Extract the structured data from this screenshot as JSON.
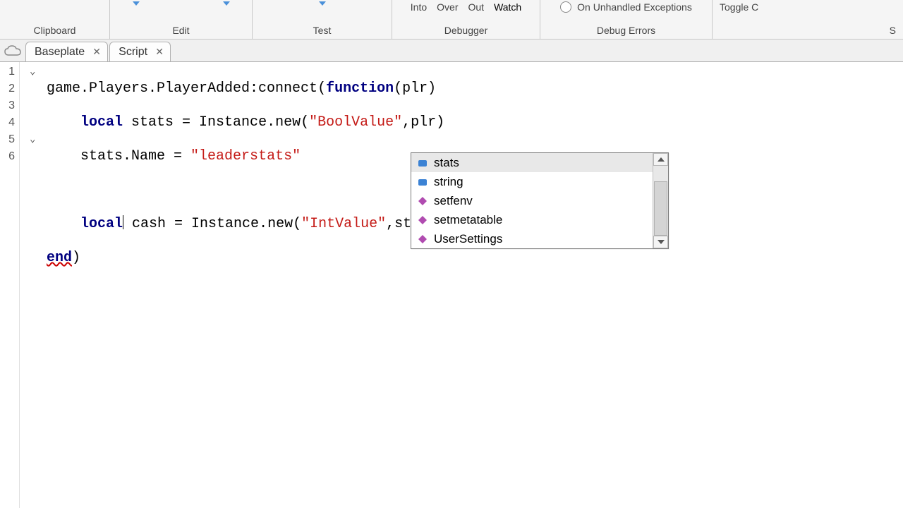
{
  "ribbon": {
    "clipboard": {
      "label": "Clipboard"
    },
    "edit": {
      "label": "Edit"
    },
    "test": {
      "label": "Test"
    },
    "debugger": {
      "label": "Debugger",
      "items": [
        "Into",
        "Over",
        "Out",
        "Watch"
      ]
    },
    "debugerrors": {
      "label": "Debug Errors",
      "option": "On Unhandled Exceptions"
    },
    "last": {
      "label": "Toggle C",
      "sub": "S"
    }
  },
  "tabs": [
    {
      "label": "Baseplate"
    },
    {
      "label": "Script"
    }
  ],
  "lineNumbers": [
    "1",
    "2",
    "3",
    "4",
    "5",
    "6"
  ],
  "code": {
    "l1_a": "game.Players.PlayerAdded:connect(",
    "l1_kw": "function",
    "l1_b": "(plr)",
    "l2_kw": "local",
    "l2_a": " stats = Instance.new(",
    "l2_str": "\"BoolValue\"",
    "l2_b": ",plr)",
    "l3_a": "    stats.Name = ",
    "l3_str": "\"leaderstats\"",
    "l5_kw": "local",
    "l5_a": " cash = Instance.new(",
    "l5_str": "\"IntValue\"",
    "l5_b": ",st",
    "l6_kw": "end",
    "l6_a": ")"
  },
  "autocomplete": {
    "items": [
      {
        "label": "stats",
        "kind": "var"
      },
      {
        "label": "string",
        "kind": "var"
      },
      {
        "label": "setfenv",
        "kind": "func"
      },
      {
        "label": "setmetatable",
        "kind": "func"
      },
      {
        "label": "UserSettings",
        "kind": "func"
      }
    ]
  }
}
